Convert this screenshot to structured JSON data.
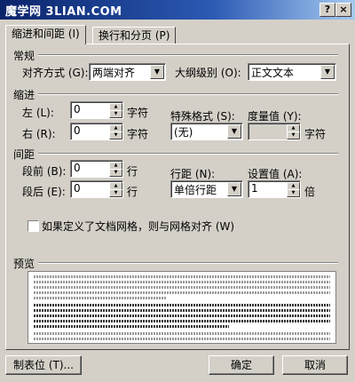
{
  "window": {
    "title": "魔学网 3LIAN.COM",
    "help_glyph": "?",
    "close_glyph": "×"
  },
  "tabs": [
    {
      "label": "缩进和间距 (I)"
    },
    {
      "label": "换行和分页 (P)"
    }
  ],
  "general": {
    "heading": "常规",
    "alignment_label": "对齐方式 (G):",
    "alignment_value": "两端对齐",
    "outline_label": "大纲级别 (O):",
    "outline_value": "正文文本"
  },
  "indent": {
    "heading": "缩进",
    "left_label": "左 (L):",
    "left_value": "0",
    "left_unit": "字符",
    "right_label": "右 (R):",
    "right_value": "0",
    "right_unit": "字符",
    "special_label": "特殊格式 (S):",
    "special_value": "(无)",
    "measure_label": "度量值 (Y):",
    "measure_value": "",
    "measure_unit": "字符"
  },
  "spacing": {
    "heading": "间距",
    "before_label": "段前 (B):",
    "before_value": "0",
    "before_unit": "行",
    "after_label": "段后 (E):",
    "after_value": "0",
    "after_unit": "行",
    "line_label": "行距 (N):",
    "line_value": "单倍行距",
    "at_label": "设置值 (A):",
    "at_value": "1",
    "at_unit": "倍"
  },
  "grid_checkbox": {
    "label": "如果定义了文档网格，则与网格对齐 (W)",
    "checked": false
  },
  "preview": {
    "heading": "预览"
  },
  "buttons": {
    "tabs": "制表位 (T)...",
    "ok": "确定",
    "cancel": "取消"
  },
  "icons": {
    "dropdown": "dropdown-arrow-icon",
    "spin_up": "up-arrow-icon",
    "spin_down": "down-arrow-icon"
  }
}
